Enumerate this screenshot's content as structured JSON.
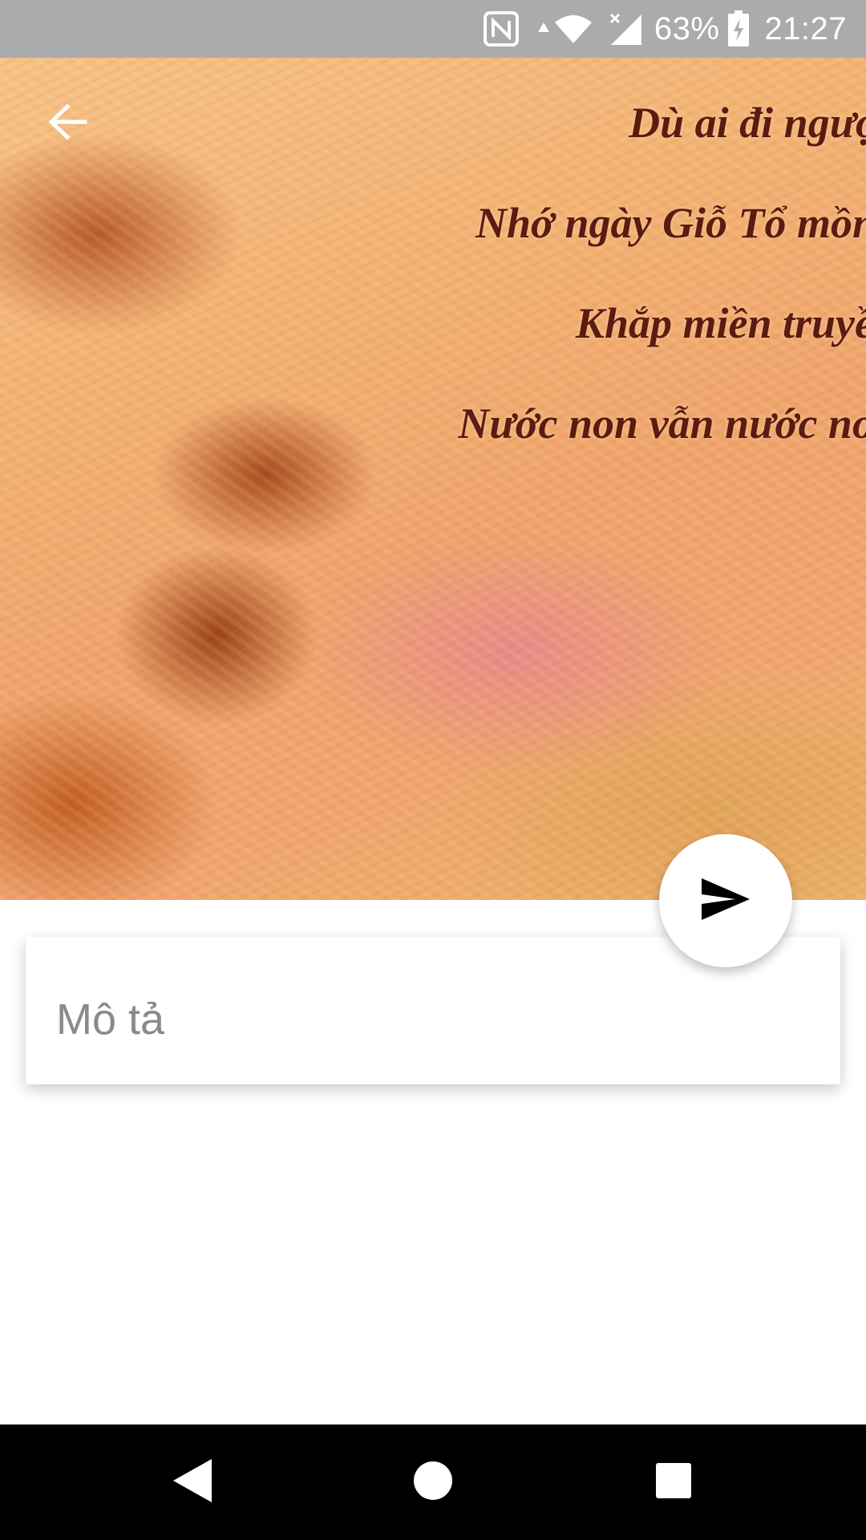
{
  "status_bar": {
    "battery": "63%",
    "time": "21:27",
    "icons": [
      "nfc-icon",
      "data-arrow-icon",
      "wifi-icon",
      "signal-icon",
      "battery-charging-icon"
    ]
  },
  "image": {
    "poem_lines": [
      "Dù ai đi ngược",
      "Nhớ ngày Giỗ Tổ mồng",
      "Khắp miền truyền",
      "Nước non vẫn nước non"
    ]
  },
  "toolbar": {
    "back_icon": "arrow-left-icon"
  },
  "fab": {
    "icon": "send-icon"
  },
  "description": {
    "placeholder": "Mô tả",
    "value": ""
  },
  "nav_bar": {
    "icons": [
      "back-triangle-icon",
      "home-circle-icon",
      "recents-square-icon"
    ]
  },
  "colors": {
    "status_bar_bg": "#ababab",
    "poem_text": "#5a1b12",
    "nav_bar_bg": "#000000"
  }
}
